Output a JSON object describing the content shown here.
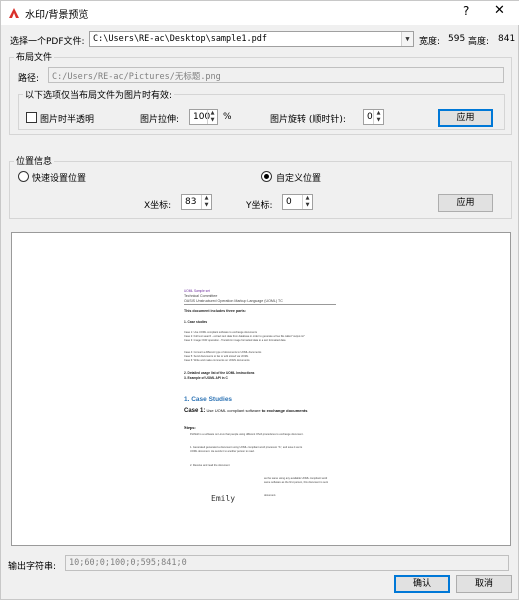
{
  "window": {
    "title": "水印/背景预览",
    "help": "?",
    "close": "✕"
  },
  "pdf": {
    "label": "选择一个PDF文件:",
    "path": "C:\\Users\\RE-ac\\Desktop\\sample1.pdf",
    "width_label": "宽度:",
    "width": "595",
    "height_label": "高度:",
    "height": "841"
  },
  "layout": {
    "group_title": "布局文件",
    "path_label": "路径:",
    "path": "C:/Users/RE-ac/Pictures/无标题.png",
    "image_group_title": "以下选项仅当布局文件为图片时有效:",
    "translucent_label": "图片时半透明",
    "translucent_checked": false,
    "stretch_label": "图片拉伸:",
    "stretch_value": "100",
    "stretch_unit": "%",
    "rotate_label": "图片旋转 (顺时针):",
    "rotate_value": "0",
    "apply_label": "应用"
  },
  "position": {
    "group_title": "位置信息",
    "quick_label": "快速设置位置",
    "custom_label": "自定义位置",
    "selected": "custom",
    "x_label": "X坐标:",
    "x_value": "83",
    "y_label": "Y坐标:",
    "y_value": "0",
    "apply_label": "应用"
  },
  "preview": {
    "doc": {
      "l1": "UOML Sample set",
      "l2": "Technical Committee",
      "l3": "OASIS Unstructured Operation Markup Language (UOML) TC",
      "l4": "This document includes three parts:",
      "l5": "1.     Case studies",
      "l6": "Case 1: Use UOML compliant software to exchange documents",
      "l7": "Case 2: Full text search - extract text data from database in order to generate a free file called \"output.txt\"",
      "l8": "Case 3: Image OCR operation - Transform image formatted data to a text formatted data",
      "l9": "Case 4: Convert a different type of documents to UOML documents",
      "l10": "Case 5: Send documents to fax or edit stored via UOML",
      "l11": "Case 6: Write and make comments on UOML documents",
      "l12": "2.     Detailed usage list of the UOML Instructions",
      "l13": "3.     Example of UOML API in C",
      "h1": "1. Case Studies",
      "h2_bold": "Case 1:",
      "h2_rest": " Use UOML compliant software ",
      "h2_bold2": "to exchange documents",
      "steps": "Steps:",
      "s1": "PoliSoft is a software on Linux that people using different OS/A procedures to exchange document.",
      "s2a": "1.     Generated generated a document using UOML compliant word processor \"A\", and save it as its",
      "s2b": "        UOML document. He sends it to another person to read.",
      "s3": "2.     Receive and read the document",
      "s4a": "as the same using any available UOML compliant word",
      "s4b": "same software as the first person, this document is sent",
      "s5": "document.",
      "watermark": "Emily"
    }
  },
  "output": {
    "label": "输出字符串:",
    "value": "10;60;0;100;0;595;841;0"
  },
  "buttons": {
    "ok": "确认",
    "cancel": "取消"
  },
  "colors": {
    "accent": "#0078d7",
    "window_bg": "#f0f0f0",
    "doc_heading": "#2e74b5",
    "doc_link": "#7030a0"
  }
}
